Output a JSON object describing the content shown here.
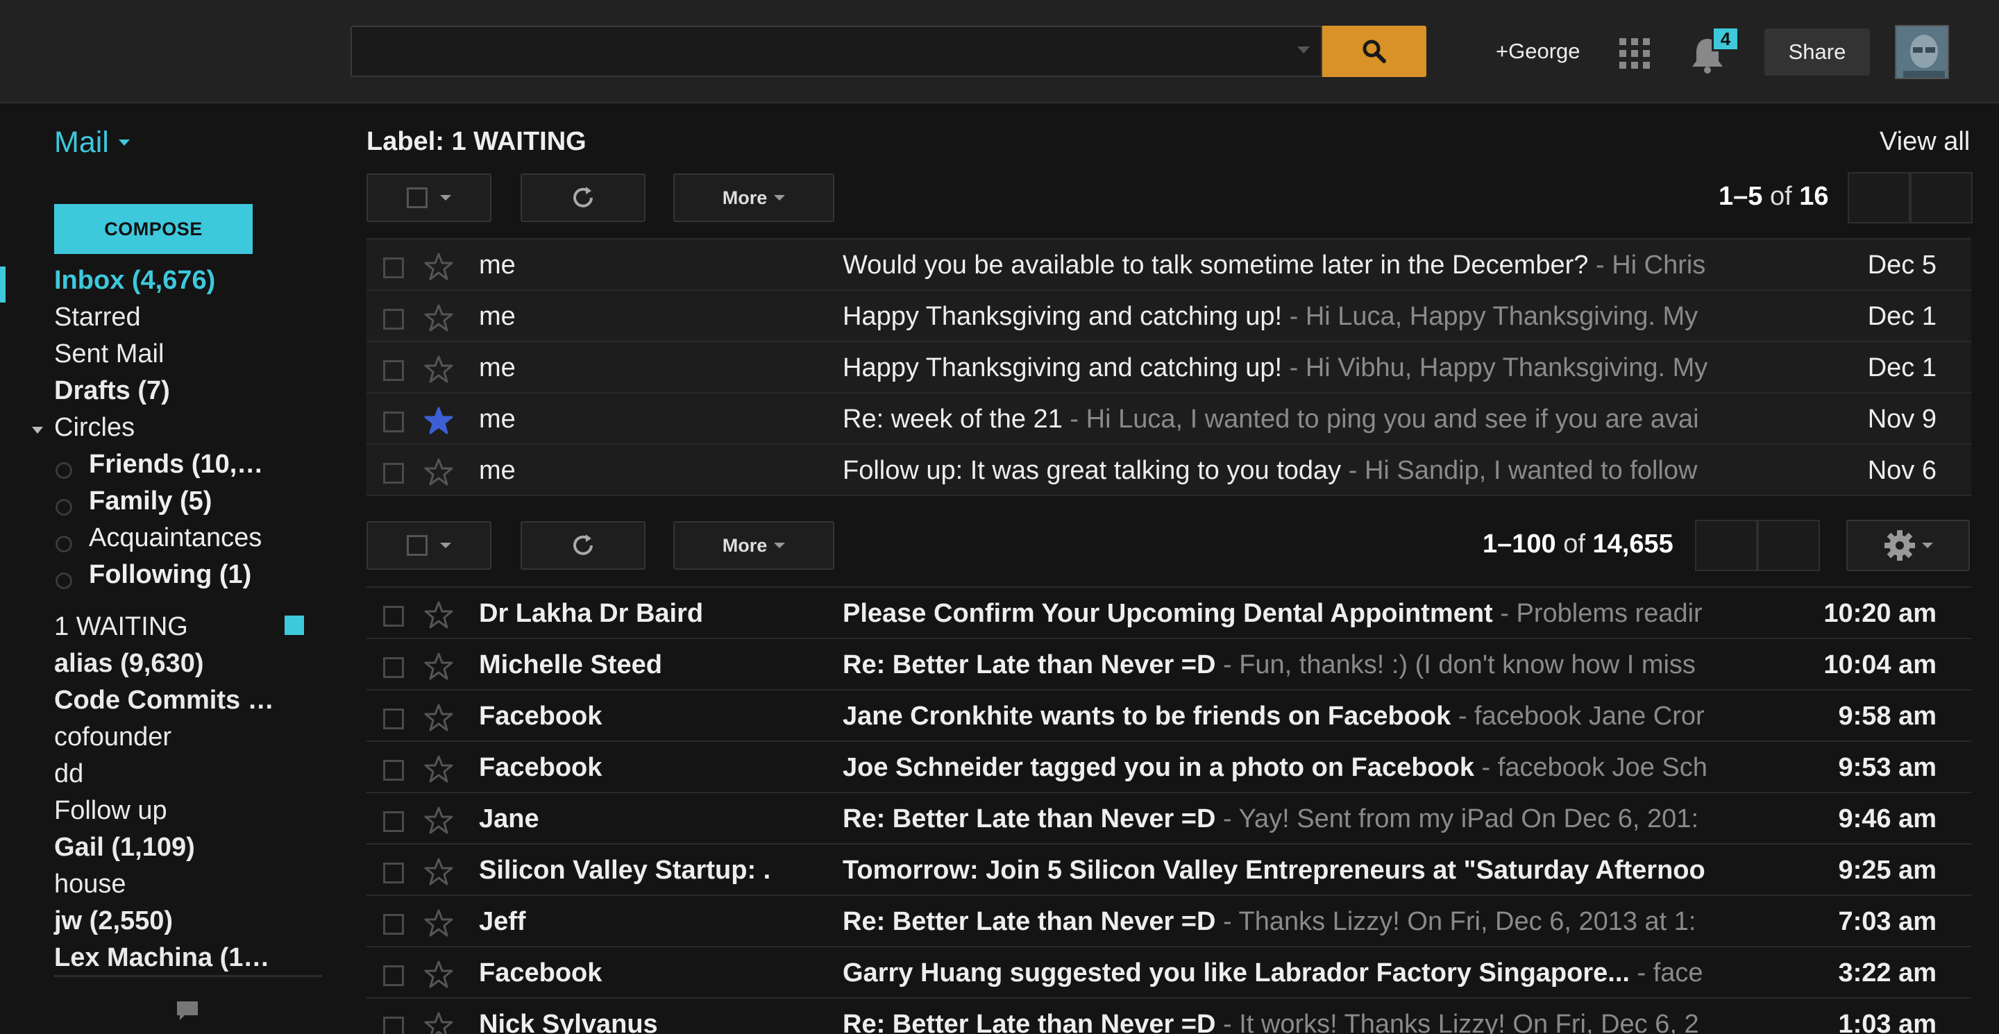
{
  "topbar": {
    "search_placeholder": "",
    "user_link": "+George",
    "notifications_count": "4",
    "share_label": "Share"
  },
  "sidebar": {
    "mail_label": "Mail",
    "compose_label": "COMPOSE",
    "items": [
      {
        "label": "Inbox (4,676)"
      },
      {
        "label": "Starred"
      },
      {
        "label": "Sent Mail"
      },
      {
        "label": "Drafts (7)"
      },
      {
        "label": "Circles"
      }
    ],
    "circles": [
      {
        "label": "Friends (10,…"
      },
      {
        "label": "Family (5)"
      },
      {
        "label": "Acquaintances"
      },
      {
        "label": "Following (1)"
      }
    ],
    "labels": [
      {
        "label": "1 WAITING",
        "color": "#3ec8dc"
      },
      {
        "label": "alias (9,630)"
      },
      {
        "label": "Code Commits …"
      },
      {
        "label": "cofounder"
      },
      {
        "label": "dd"
      },
      {
        "label": "Follow up"
      },
      {
        "label": "Gail (1,109)"
      },
      {
        "label": "house"
      },
      {
        "label": "jw (2,550)"
      },
      {
        "label": "Lex Machina (1…"
      }
    ]
  },
  "label_view": {
    "title": "Label: 1 WAITING",
    "view_all": "View all",
    "more_label": "More",
    "pager_range": "1–5",
    "pager_of": "of",
    "pager_total": "16"
  },
  "top_emails": [
    {
      "from": "me",
      "subject": "Would you be available to talk sometime later in the December?",
      "snippet": " - Hi Chris",
      "date": "Dec 5",
      "starred": false
    },
    {
      "from": "me",
      "subject": "Happy Thanksgiving and catching up!",
      "snippet": " - Hi Luca, Happy Thanksgiving. My",
      "date": "Dec 1",
      "starred": false
    },
    {
      "from": "me",
      "subject": "Happy Thanksgiving and catching up!",
      "snippet": " - Hi Vibhu, Happy Thanksgiving. My",
      "date": "Dec 1",
      "starred": false
    },
    {
      "from": "me",
      "subject": "Re: week of the 21",
      "snippet": " - Hi Luca, I wanted to ping you and see if you are avai",
      "date": "Nov 9",
      "starred": true
    },
    {
      "from": "me",
      "subject": "Follow up: It was great talking to you today",
      "snippet": " - Hi Sandip, I wanted to follow",
      "date": "Nov 6",
      "starred": false
    }
  ],
  "inbox_view": {
    "more_label": "More",
    "pager_range": "1–100",
    "pager_of": "of",
    "pager_total": "14,655"
  },
  "inbox_emails": [
    {
      "from": "Dr Lakha Dr Baird",
      "subject": "Please Confirm Your Upcoming Dental Appointment",
      "snippet": " - Problems readir",
      "date": "10:20 am"
    },
    {
      "from": "Michelle Steed",
      "subject": "Re: Better Late than Never =D",
      "snippet": " - Fun, thanks! :) (I don't know how I miss",
      "date": "10:04 am"
    },
    {
      "from": "Facebook",
      "subject": "Jane Cronkhite wants to be friends on Facebook",
      "snippet": " - facebook Jane Cror",
      "date": "9:58 am"
    },
    {
      "from": "Facebook",
      "subject": "Joe Schneider tagged you in a photo on Facebook",
      "snippet": " - facebook Joe Sch",
      "date": "9:53 am"
    },
    {
      "from": "Jane",
      "subject": "Re: Better Late than Never =D",
      "snippet": " - Yay! Sent from my iPad On Dec 6, 201:",
      "date": "9:46 am"
    },
    {
      "from": "Silicon Valley Startup: .",
      "subject": "Tomorrow: Join 5 Silicon Valley Entrepreneurs at \"Saturday Afternoo",
      "snippet": "",
      "date": "9:25 am"
    },
    {
      "from": "Jeff",
      "subject": "Re: Better Late than Never =D",
      "snippet": " - Thanks Lizzy! On Fri, Dec 6, 2013 at 1:",
      "date": "7:03 am"
    },
    {
      "from": "Facebook",
      "subject": "Garry Huang suggested you like Labrador Factory Singapore...",
      "snippet": " - face",
      "date": "3:22 am"
    },
    {
      "from": "Nick Sylvanus",
      "subject": "Re: Better Late than Never =D",
      "snippet": " - It works! Thanks Lizzy! On Fri, Dec 6, 2",
      "date": "1:03 am"
    }
  ],
  "colors": {
    "accent": "#3ec8dc",
    "search_button": "#d99227",
    "starred": "#3d5fd6"
  }
}
